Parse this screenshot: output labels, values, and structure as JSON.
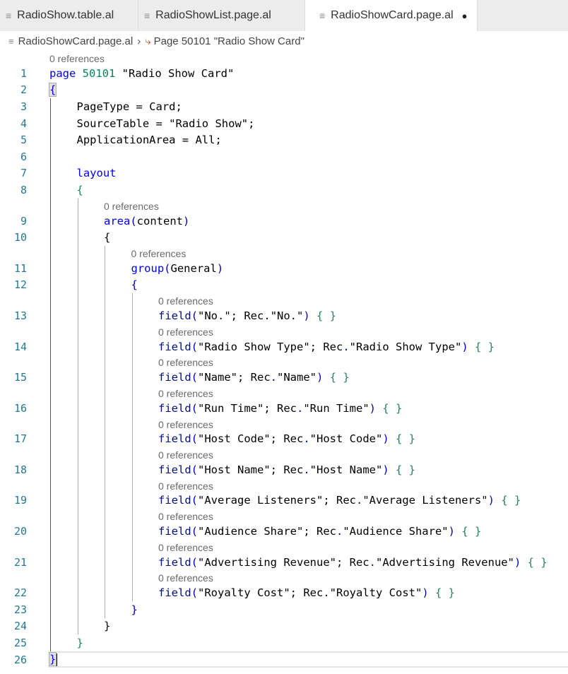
{
  "tabs": [
    {
      "label": "RadioShow.table.al",
      "icon": "file-lines-icon",
      "active": false
    },
    {
      "label": "RadioShowList.page.al",
      "icon": "file-lines-icon",
      "active": false
    },
    {
      "label": "RadioShowCard.page.al",
      "icon": "file-lines-icon",
      "active": true,
      "modified": true
    }
  ],
  "breadcrumb": {
    "file": "RadioShowCard.page.al",
    "symbol": "Page 50101 \"Radio Show Card\""
  },
  "codelens": "0 references",
  "lines": [
    {
      "n": "1",
      "lens": true,
      "indent": 0,
      "parts": [
        [
          "kw",
          "page"
        ],
        [
          "",
          "&nbsp;"
        ],
        [
          "num",
          "50101"
        ],
        [
          "",
          ""
        ],
        [
          "",
          "&nbsp;\"Radio Show Card\""
        ]
      ]
    },
    {
      "n": "2",
      "indent": 0,
      "brace": "{",
      "bcls": "kw box"
    },
    {
      "n": "3",
      "indent": 1,
      "text": "PageType = Card;"
    },
    {
      "n": "4",
      "indent": 1,
      "text": "SourceTable = \"Radio Show\";"
    },
    {
      "n": "5",
      "indent": 1,
      "text": "ApplicationArea = All;"
    },
    {
      "n": "6",
      "indent": 1,
      "text": ""
    },
    {
      "n": "7",
      "indent": 1,
      "kwtext": "layout"
    },
    {
      "n": "8",
      "indent": 1,
      "brace": "{",
      "bcls": "gr"
    },
    {
      "n": "9",
      "lens": true,
      "indent": 2,
      "call": "area",
      "arg": "content"
    },
    {
      "n": "10",
      "indent": 2,
      "brace": "{",
      "bcls": ""
    },
    {
      "n": "11",
      "lens": true,
      "indent": 3,
      "call": "group",
      "arg": "General"
    },
    {
      "n": "12",
      "indent": 3,
      "brace": "{",
      "bcls": "fn"
    },
    {
      "n": "13",
      "lens": true,
      "indent": 4,
      "field": "No."
    },
    {
      "n": "14",
      "lens": true,
      "indent": 4,
      "field": "Radio Show Type"
    },
    {
      "n": "15",
      "lens": true,
      "indent": 4,
      "field": "Name"
    },
    {
      "n": "16",
      "lens": true,
      "indent": 4,
      "field": "Run Time"
    },
    {
      "n": "17",
      "lens": true,
      "indent": 4,
      "field": "Host Code"
    },
    {
      "n": "18",
      "lens": true,
      "indent": 4,
      "field": "Host Name"
    },
    {
      "n": "19",
      "lens": true,
      "indent": 4,
      "field": "Average Listeners"
    },
    {
      "n": "20",
      "lens": true,
      "indent": 4,
      "field": "Audience Share"
    },
    {
      "n": "21",
      "lens": true,
      "indent": 4,
      "field": "Advertising Revenue"
    },
    {
      "n": "22",
      "lens": true,
      "indent": 4,
      "field": "Royalty Cost"
    },
    {
      "n": "23",
      "indent": 3,
      "brace": "}",
      "bcls": "fn",
      "guides": 3
    },
    {
      "n": "24",
      "indent": 2,
      "brace": "}",
      "bcls": "",
      "guides": 2
    },
    {
      "n": "25",
      "indent": 1,
      "brace": "}",
      "bcls": "gr",
      "guides": 1
    },
    {
      "n": "26",
      "indent": 0,
      "brace": "}",
      "bcls": "kw box",
      "current": true,
      "guides": 0
    }
  ]
}
